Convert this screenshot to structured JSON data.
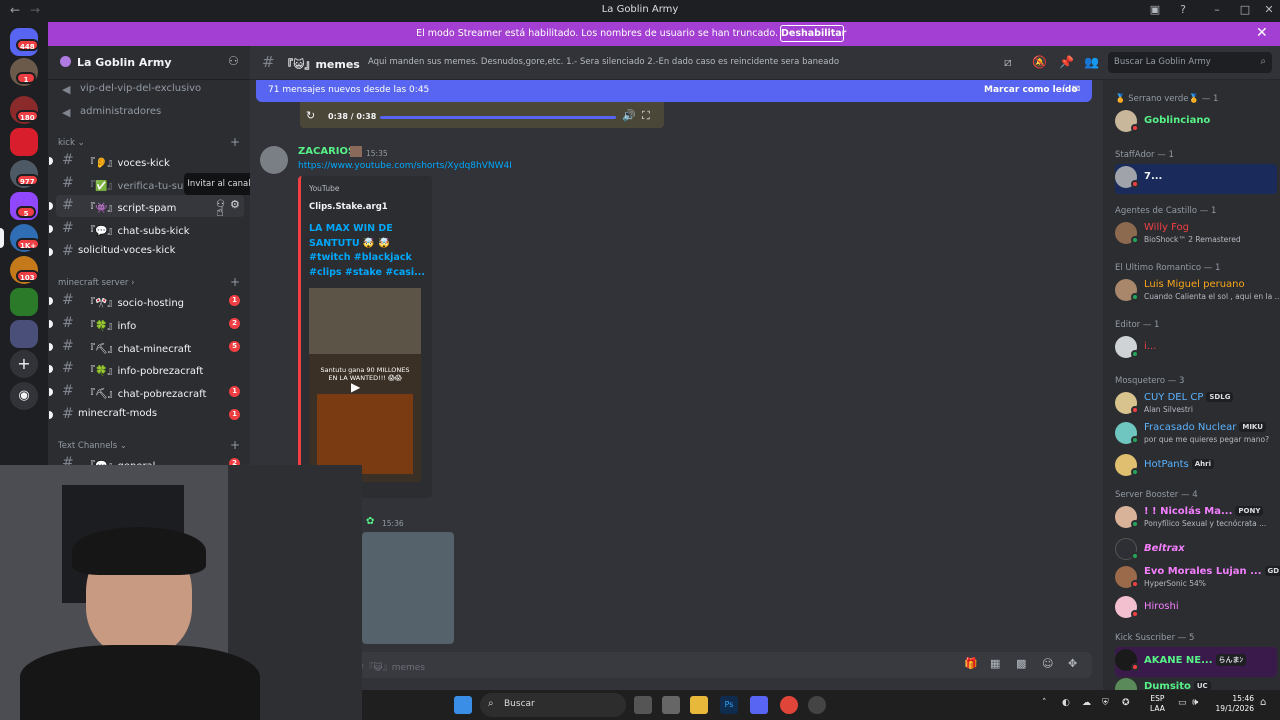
{
  "titlebar": {
    "title": "La Goblin Army"
  },
  "banner": {
    "message": "El modo Streamer está habilitado. Los nombres de usuario se han truncado.",
    "button": "Deshabilitar"
  },
  "guild_badges": [
    "448",
    "1",
    "180",
    "977",
    "5",
    "1K+",
    "103"
  ],
  "server": {
    "name": "La Goblin Army"
  },
  "channels": {
    "voice": [
      {
        "name": "vip-del-vip-del-exclusivo"
      },
      {
        "name": "administradores"
      }
    ],
    "kick": {
      "category": "kick",
      "items": [
        {
          "name": "『👂』voces-kick",
          "badge": ""
        },
        {
          "name": "『✅』verifica-tu-sub",
          "badge": ""
        },
        {
          "name": "『👾』script-spam",
          "badge": ""
        },
        {
          "name": "『💬』chat-subs-kick",
          "badge": ""
        },
        {
          "name": "solicitud-voces-kick",
          "badge": ""
        }
      ]
    },
    "minecraft": {
      "category": "minecraft server",
      "items": [
        {
          "name": "『🎌』socio-hosting",
          "badge": "1"
        },
        {
          "name": "『🍀』info",
          "badge": "2"
        },
        {
          "name": "『⛏』chat-minecraft",
          "badge": "5"
        },
        {
          "name": "『🍀』info-pobrezacraft",
          "badge": "1"
        },
        {
          "name": "『⛏』chat-pobrezacraft",
          "badge": "1"
        },
        {
          "name": "minecraft-mods",
          "badge": "1"
        }
      ]
    },
    "text": {
      "category": "Text Channels",
      "items": [
        {
          "name": "『💬』general",
          "badge": "2"
        }
      ]
    }
  },
  "tooltip": "Invitar al canal",
  "topbar": {
    "channel": "『😺』memes",
    "topic": "Aqui manden sus memes. Desnudos,gore,etc. 1.- Sera silenciado 2.-En dado caso es reincidente sera baneado",
    "search_placeholder": "Buscar La Goblin Army"
  },
  "newbar": {
    "text": "71 mensajes nuevos desde las 0:45",
    "action": "Marcar como leído"
  },
  "audio": {
    "time": "0:38 / 0:38"
  },
  "message": {
    "author": "ZACARIOS",
    "time": "15:35",
    "link": "https://www.youtube.com/shorts/Xydq8hVNW4I",
    "embed": {
      "provider": "YouTube",
      "channel": "Clips.Stake.arg1",
      "title_line1": "LA MAX WIN DE",
      "title_line2": "SANTUTU 🤯 🤯",
      "title_line3": "#twitch #blackjack",
      "title_line4": "#clips #stake #casi...",
      "thumb_text1": "Santutu gana 90 MILLONES",
      "thumb_text2": "EN LA WANTED!!! 😱😱"
    }
  },
  "message2": {
    "time": "15:36"
  },
  "composer": {
    "placeholder": "Enviar mensaje a #『😺』memes"
  },
  "members": [
    {
      "category": "🏅 Serrano verde🏅 — 1",
      "items": [
        {
          "name": "Goblinciano",
          "sub": "",
          "color": "#57f287",
          "tag": ""
        }
      ]
    },
    {
      "category": "StaffAdor — 1",
      "items": [
        {
          "name": "7...",
          "sub": "",
          "color": "#f2f3f5",
          "tag": ""
        }
      ]
    },
    {
      "category": "Agentes de Castillo — 1",
      "items": [
        {
          "name": "Willy Fog",
          "sub": "BioShock™ 2 Remastered",
          "color": "#f23f43",
          "tag": ""
        }
      ]
    },
    {
      "category": "El Ultimo Romantico — 1",
      "items": [
        {
          "name": "Luis Miguel peruano",
          "sub": "Cuando Calienta el sol , aqui en la ...",
          "color": "#faa61a",
          "tag": ""
        }
      ]
    },
    {
      "category": "Editor — 1",
      "items": [
        {
          "name": "i...",
          "sub": "",
          "color": "#f23f43",
          "tag": ""
        }
      ]
    },
    {
      "category": "Mosquetero — 3",
      "items": [
        {
          "name": "CUY DEL CP",
          "sub": "Alan Silvestri",
          "color": "#5ab3ff",
          "tag": "SDLG"
        },
        {
          "name": "Fracasado Nuclear",
          "sub": "por que me quieres pegar mano?",
          "color": "#5ab3ff",
          "tag": "MIKU"
        },
        {
          "name": "HotPants",
          "sub": "",
          "color": "#5ab3ff",
          "tag": "Ahri"
        }
      ]
    },
    {
      "category": "Server Booster — 4",
      "items": [
        {
          "name": "! ! Nicolás Ma...",
          "sub": "Ponyfílico Sexual y tecnócrata ...",
          "color": "#f47fff",
          "tag": "PONY"
        },
        {
          "name": "Beltrax",
          "sub": "",
          "color": "#f47fff",
          "tag": ""
        },
        {
          "name": "Evo Morales Lujan ...",
          "sub": "HyperSonic 54%",
          "color": "#f47fff",
          "tag": "GD"
        },
        {
          "name": "Hiroshi",
          "sub": "",
          "color": "#f47fff",
          "tag": ""
        }
      ]
    },
    {
      "category": "Kick Suscriber — 5",
      "items": [
        {
          "name": "AKANE NE...",
          "sub": "",
          "color": "#57f287",
          "tag": "らんまﾝ"
        },
        {
          "name": "Dumsito",
          "sub": "",
          "color": "#57f287",
          "tag": "UC"
        }
      ]
    }
  ],
  "taskbar": {
    "search": "Buscar",
    "lang1": "ESP",
    "lang2": "LAA",
    "time": "15:46",
    "date": "19/1/2026"
  }
}
